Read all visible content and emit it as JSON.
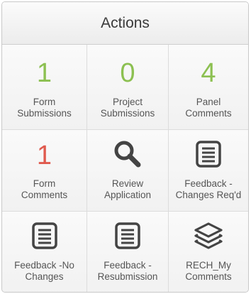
{
  "header": {
    "title": "Actions"
  },
  "colors": {
    "green": "#8cc051",
    "red": "#e05a4e",
    "icon_dark": "#444444"
  },
  "tiles": [
    {
      "count": "1",
      "label_line1": "Form",
      "label_line2": "Submissions"
    },
    {
      "count": "0",
      "label_line1": "Project",
      "label_line2": "Submissions"
    },
    {
      "count": "4",
      "label_line1": "Panel",
      "label_line2": "Comments"
    },
    {
      "count": "1",
      "label_line1": "Form",
      "label_line2": "Comments"
    },
    {
      "icon": "search-icon",
      "label_line1": "Review",
      "label_line2": "Application"
    },
    {
      "icon": "document-icon",
      "label_line1": "Feedback -",
      "label_line2": "Changes Req'd"
    },
    {
      "icon": "document-icon",
      "label_line1": "Feedback -No",
      "label_line2": "Changes"
    },
    {
      "icon": "document-icon",
      "label_line1": "Feedback -",
      "label_line2": "Resubmission"
    },
    {
      "icon": "layers-icon",
      "label_line1": "RECH_My",
      "label_line2": "Comments"
    }
  ]
}
